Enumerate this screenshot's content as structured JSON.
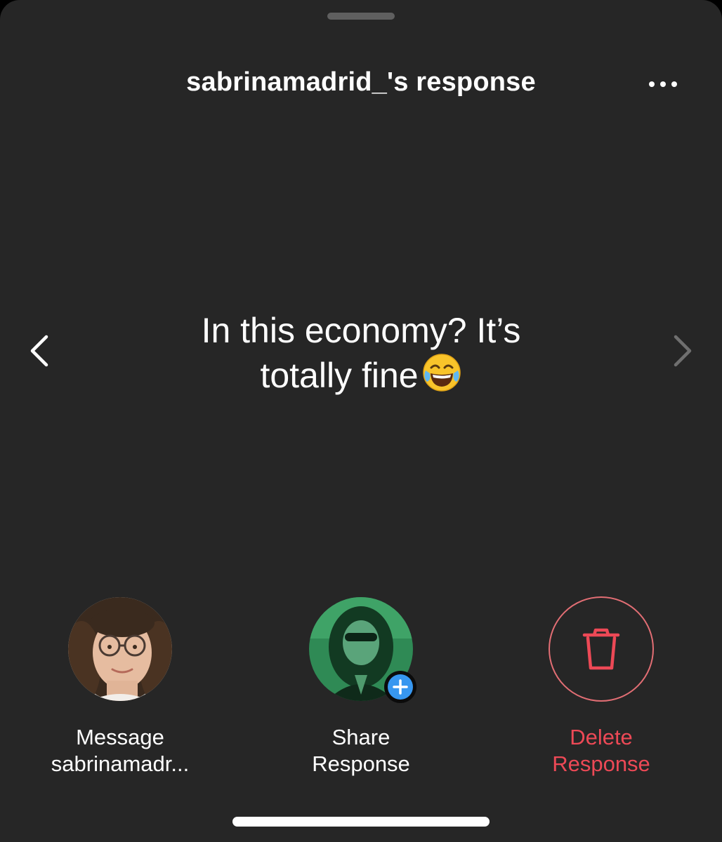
{
  "sheet": {
    "title": "sabrinamadrid_'s response",
    "more_icon": "more-horizontal-icon"
  },
  "navigation": {
    "previous_icon": "chevron-left-icon",
    "next_icon": "chevron-right-icon"
  },
  "response": {
    "line1": "In this economy? It’s",
    "line2": "totally fine",
    "emoji": "face-with-tears-of-joy-emoji"
  },
  "actions": [
    {
      "line1": "Message",
      "line2": "sabrinamadr...",
      "icon": "profile-avatar"
    },
    {
      "line1": "Share",
      "line2": "Response",
      "icon": "own-avatar-with-plus-badge"
    },
    {
      "line1": "Delete",
      "line2": "Response",
      "icon": "trash-icon"
    }
  ],
  "colors": {
    "background": "#262626",
    "text": "#ffffff",
    "destructive": "#ed4956",
    "badge_blue": "#3797f0"
  }
}
